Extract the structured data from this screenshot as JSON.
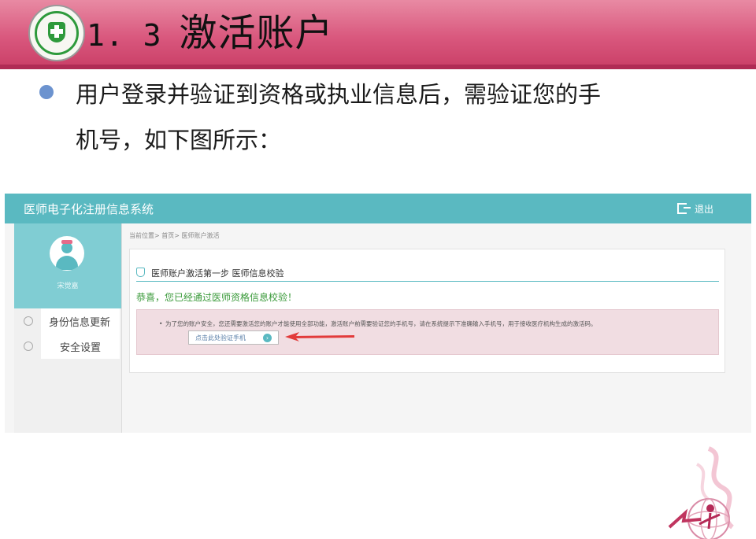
{
  "slide": {
    "number": "1. 3",
    "title": "激活账户",
    "bullet_line1": "用户登录并验证到资格或执业信息后，需验证您的手",
    "bullet_line2": "机号，如下图所示："
  },
  "app": {
    "title": "医师电子化注册信息系统",
    "logout_label": "退出",
    "accent_color": "#5ab9c1",
    "user_name": "宋觉嘉",
    "sidebar": [
      {
        "label": "身份信息更新",
        "icon": "id-card-icon"
      },
      {
        "label": "安全设置",
        "icon": "user-icon"
      }
    ],
    "breadcrumb": "当前位置> 首页> 医师账户激活",
    "step_title": "医师账户激活第一步 医师信息校验",
    "success_message": "恭喜，您已经通过医师资格信息校验！",
    "notice_text": "为了您的账户安全，您还需要激活您的账户才能使用全部功能，激活账户前需要验证您的手机号，请在系统提示下准确输入手机号，用于接收医疗机构生成的激活码。",
    "verify_button": "点击此处验证手机"
  }
}
